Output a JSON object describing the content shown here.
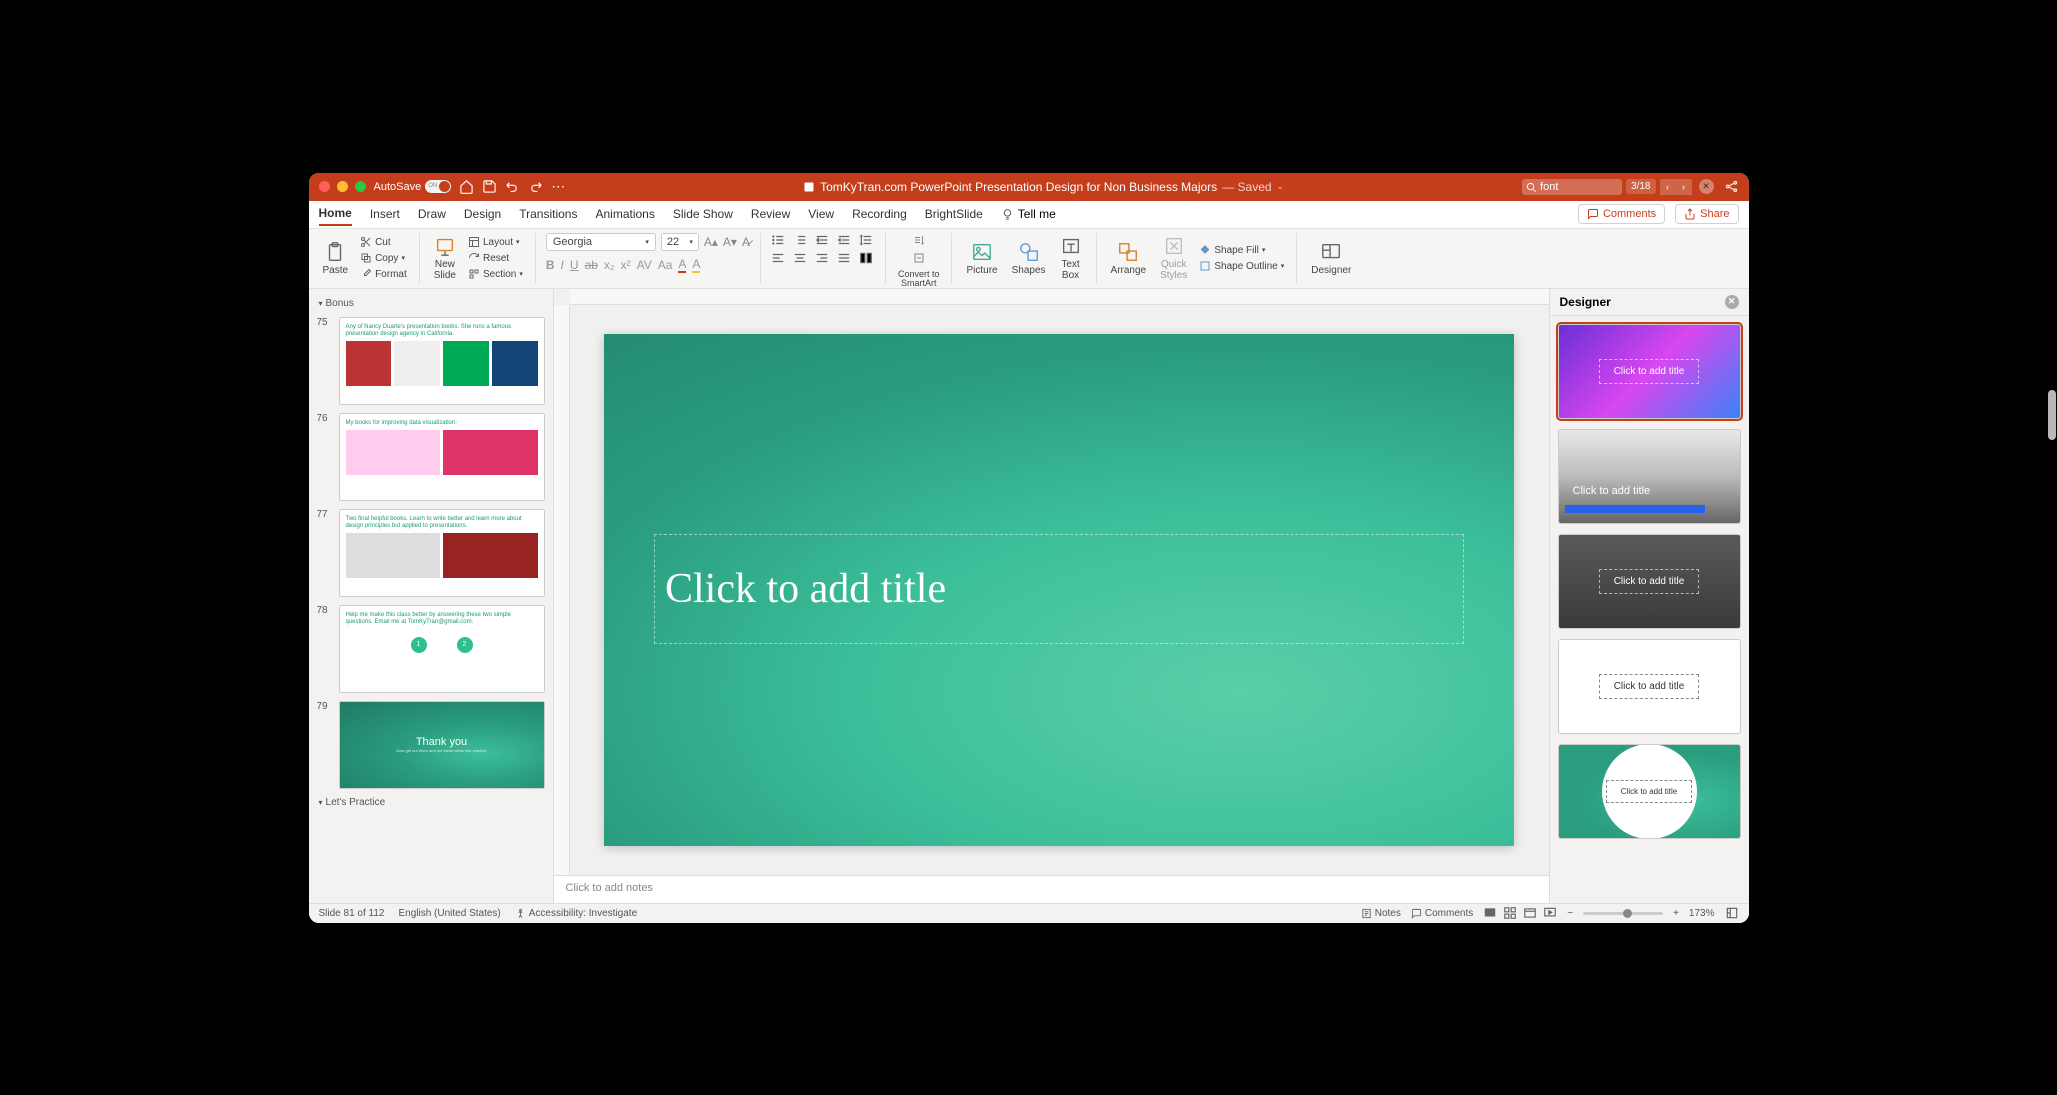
{
  "titlebar": {
    "autosave_label": "AutoSave",
    "autosave_state": "ON",
    "doc_title": "TomKyTran.com PowerPoint Presentation Design for Non Business Majors",
    "save_state": "— Saved",
    "search_value": "font",
    "search_count": "3/18"
  },
  "menubar": {
    "tabs": [
      "Home",
      "Insert",
      "Draw",
      "Design",
      "Transitions",
      "Animations",
      "Slide Show",
      "Review",
      "View",
      "Recording",
      "BrightSlide"
    ],
    "active": "Home",
    "tellme": "Tell me",
    "comments": "Comments",
    "share": "Share"
  },
  "ribbon": {
    "paste": "Paste",
    "cut": "Cut",
    "copy": "Copy",
    "format": "Format",
    "new_slide": "New\nSlide",
    "layout": "Layout",
    "reset": "Reset",
    "section": "Section",
    "font_name": "Georgia",
    "font_size": "22",
    "convert": "Convert to\nSmartArt",
    "picture": "Picture",
    "shapes": "Shapes",
    "textbox": "Text\nBox",
    "arrange": "Arrange",
    "quick": "Quick\nStyles",
    "shape_fill": "Shape Fill",
    "shape_outline": "Shape Outline",
    "designer": "Designer"
  },
  "slidepanel": {
    "section1": "Bonus",
    "section2": "Let's Practice",
    "items": [
      {
        "num": "75",
        "title": "Any of Nancy Duarte's presentation books. She runs a famous presentation design agency in California."
      },
      {
        "num": "76",
        "title": "My books for improving data visualization:"
      },
      {
        "num": "77",
        "title": "Two final helpful books. Learn to write better and learn more about design principles but applied to presentations."
      },
      {
        "num": "78",
        "title": "Help me make this class better by answering these two simple questions. Email me at TomKyTran@gmail.com."
      },
      {
        "num": "79",
        "title": "Thank you",
        "subtitle": "Now get out there and put these ideas into practice"
      }
    ]
  },
  "canvas": {
    "title_placeholder": "Click to add title",
    "notes_placeholder": "Click to add notes"
  },
  "designer": {
    "title": "Designer",
    "opt_label": "Click to add title"
  },
  "statusbar": {
    "slide": "Slide 81 of 112",
    "lang": "English (United States)",
    "access": "Accessibility: Investigate",
    "notes": "Notes",
    "comments": "Comments",
    "zoom": "173%"
  }
}
